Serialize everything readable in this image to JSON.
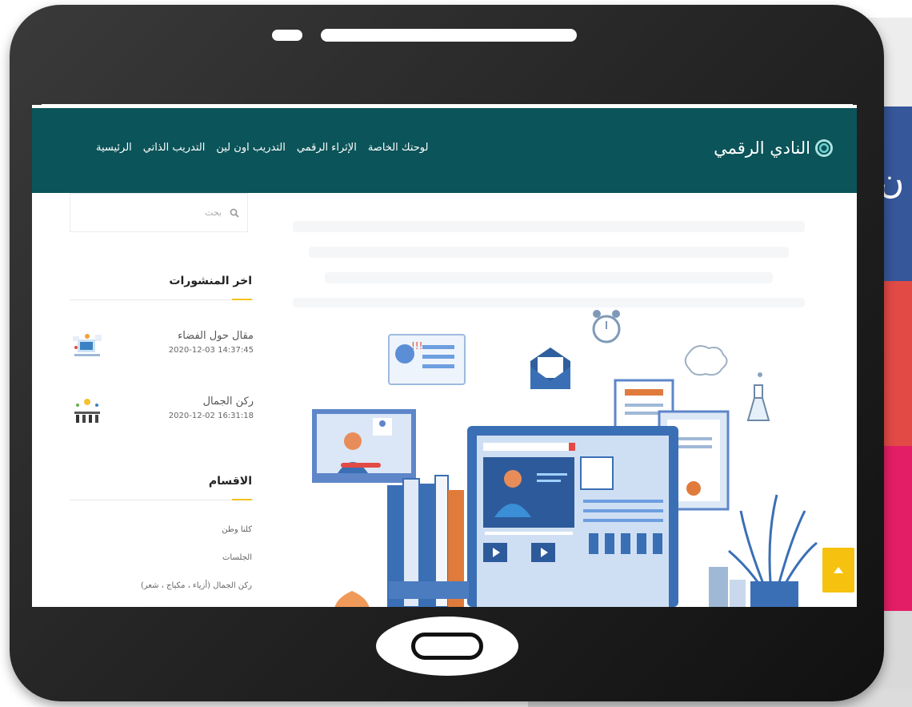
{
  "colors": {
    "navbar": "#0b5459",
    "accent": "#f6c21b",
    "scroll_button": "#f7c20f",
    "side_blue": "#36579a",
    "side_red": "#e24a46",
    "side_pink": "#e41e66"
  },
  "side_strip": {
    "glyph": "ن"
  },
  "site": {
    "name": "النادي الرقمي",
    "logo_icon": "fingerprint-icon"
  },
  "nav": {
    "items": [
      "الرئيسية",
      "التدريب الذاتي",
      "التدريب اون لين",
      "الإثراء الرقمي",
      "لوحتك الخاصة"
    ]
  },
  "search": {
    "placeholder": "بحث",
    "icon": "search-icon"
  },
  "recent_posts": {
    "title": "اخر المنشورات",
    "items": [
      {
        "title": "مقال حول الفضاء",
        "date": "2020-12-03 14:37:45"
      },
      {
        "title": "ركن الجمال",
        "date": "2020-12-02 16:31:18"
      }
    ]
  },
  "categories": {
    "title": "الاقسام",
    "items": [
      "كلنا وطن",
      "الجلسات",
      "ركن الجمال (أزياء ، مكياج ، شعر)"
    ]
  },
  "scroll_top": {
    "icon": "arrow-up-icon"
  }
}
